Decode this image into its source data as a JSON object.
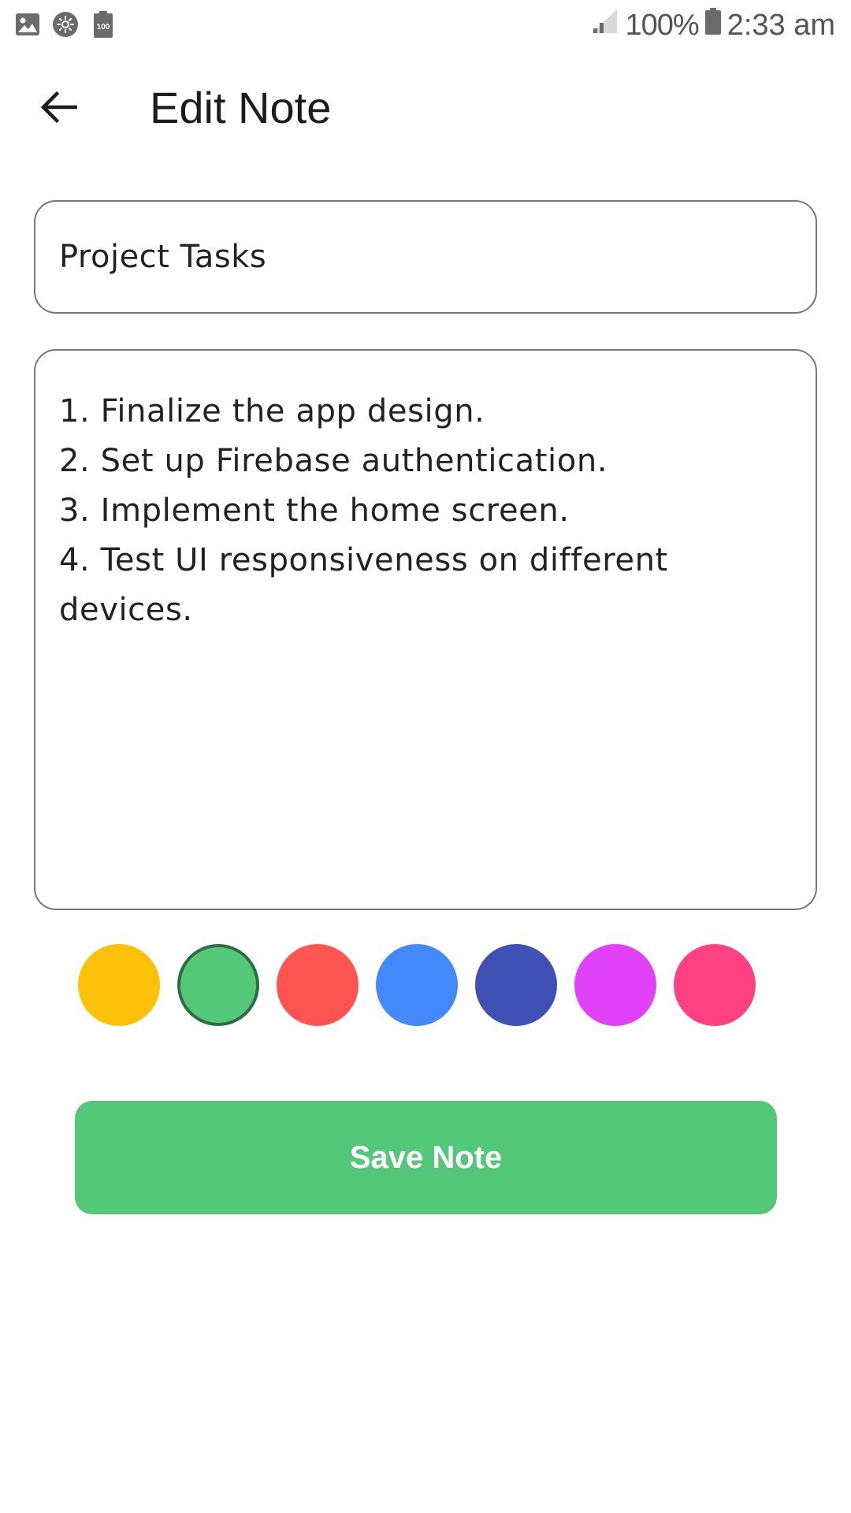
{
  "status_bar": {
    "left_icons": [
      "gallery-icon",
      "brightness-icon",
      "battery-saver-icon"
    ],
    "battery_saver_label": "100",
    "battery_percent": "100%",
    "time": "2:33 am"
  },
  "app_bar": {
    "back_icon": "arrow-back-icon",
    "title": "Edit Note"
  },
  "form": {
    "title_value": "Project Tasks",
    "content_value": "1. Finalize the app design.\n2. Set up Firebase authentication.\n3. Implement the home screen.\n4. Test UI responsiveness on different devices."
  },
  "color_picker": {
    "selected_index": 1,
    "selected_border_color": "#2c6e3f",
    "colors": [
      "#fec10a",
      "#52c878",
      "#ff5450",
      "#4489fb",
      "#3f51b5",
      "#e041f9",
      "#ff4181"
    ]
  },
  "save_button": {
    "label": "Save Note",
    "color": "#52c878"
  }
}
